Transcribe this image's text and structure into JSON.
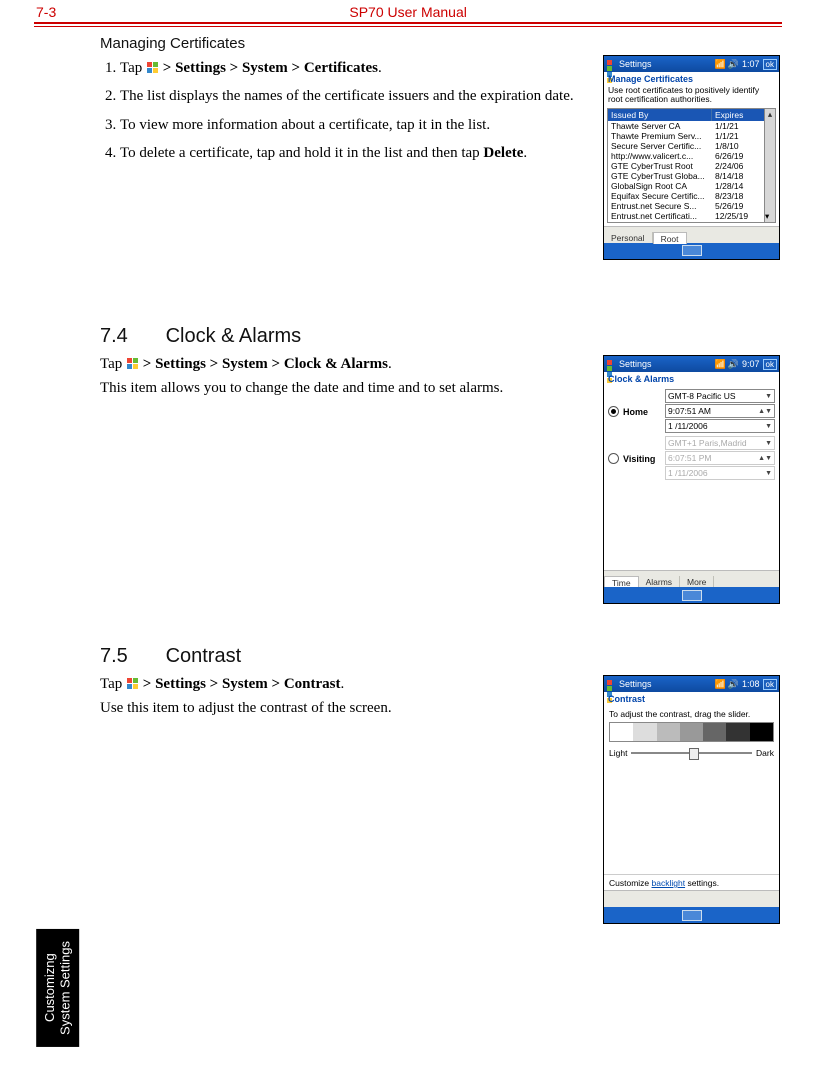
{
  "header": {
    "page_num": "7-3",
    "title": "SP70 User Manual"
  },
  "side_tab": {
    "line1": "Customizng",
    "line2": "System Settings"
  },
  "sec_certs": {
    "heading": "Managing Certificates",
    "steps_prefix_1": "Tap ",
    "steps_path_1": " > Settings > System > Certificates",
    "step2": "The list displays the names of the certificate issuers and the expiration date.",
    "step3": "To view more information about a certificate, tap it in the list.",
    "step4_a": "To delete a certificate, tap and hold it in the list and then tap ",
    "step4_b": "Delete",
    "device": {
      "titlebar_title": "Settings",
      "time": "1:07",
      "ok": "ok",
      "subtitle": "Manage Certificates",
      "note": "Use root certificates to positively identify root certification authorities.",
      "col1": "Issued By",
      "col2": "Expires",
      "rows": [
        {
          "c1": "Thawte Server CA",
          "c2": "1/1/21"
        },
        {
          "c1": "Thawte Premium Serv...",
          "c2": "1/1/21"
        },
        {
          "c1": "Secure Server Certific...",
          "c2": "1/8/10"
        },
        {
          "c1": "http://www.valicert.c...",
          "c2": "6/26/19"
        },
        {
          "c1": "GTE CyberTrust Root",
          "c2": "2/24/06"
        },
        {
          "c1": "GTE CyberTrust Globa...",
          "c2": "8/14/18"
        },
        {
          "c1": "GlobalSign Root CA",
          "c2": "1/28/14"
        },
        {
          "c1": "Equifax Secure Certific...",
          "c2": "8/23/18"
        },
        {
          "c1": "Entrust.net Secure S...",
          "c2": "5/26/19"
        },
        {
          "c1": "Entrust.net Certificati...",
          "c2": "12/25/19"
        }
      ],
      "tab1": "Personal",
      "tab2": "Root"
    }
  },
  "sec_clock": {
    "num": "7.4",
    "title": "Clock & Alarms",
    "line_prefix": "Tap ",
    "line_path": " > Settings > System > Clock & Alarms",
    "desc": "This item allows you to change the date and time and to set alarms.",
    "device": {
      "titlebar_title": "Settings",
      "time": "9:07",
      "ok": "ok",
      "subtitle": "Clock & Alarms",
      "home_label": "Home",
      "home_tz": "GMT-8 Pacific US",
      "home_time": "9:07:51 AM",
      "home_date": "1 /11/2006",
      "visit_label": "Visiting",
      "visit_tz": "GMT+1 Paris,Madrid",
      "visit_time": "6:07:51 PM",
      "visit_date": "1 /11/2006",
      "tab1": "Time",
      "tab2": "Alarms",
      "tab3": "More"
    }
  },
  "sec_contrast": {
    "num": "7.5",
    "title": "Contrast",
    "line_prefix": "Tap ",
    "line_path": " > Settings > System > Contrast",
    "desc": "Use this item to adjust the contrast of the screen.",
    "device": {
      "titlebar_title": "Settings",
      "time": "1:08",
      "ok": "ok",
      "subtitle": "Contrast",
      "note": "To adjust the contrast, drag the slider.",
      "left": "Light",
      "right": "Dark",
      "footer_a": "Customize ",
      "footer_link": "backlight",
      "footer_b": " settings."
    }
  }
}
